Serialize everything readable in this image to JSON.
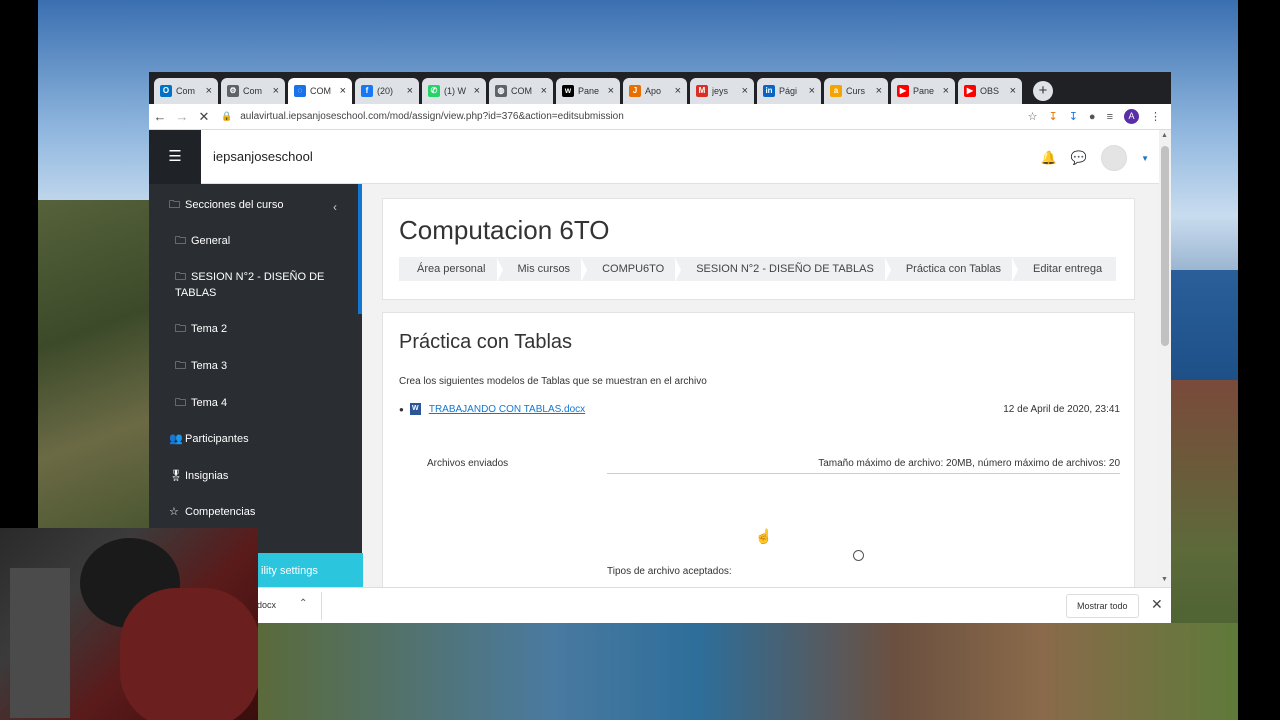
{
  "browser": {
    "tabs": [
      {
        "label": "Com",
        "favicon": "outlook-icon",
        "color": "#0072c6"
      },
      {
        "label": "Com",
        "favicon": "settings-icon",
        "color": "#5f6368"
      },
      {
        "label": "COM",
        "favicon": "loading-icon",
        "color": "#1a73e8"
      },
      {
        "label": "(20)",
        "favicon": "facebook-icon",
        "color": "#1877f2"
      },
      {
        "label": "(1) W",
        "favicon": "whatsapp-icon",
        "color": "#25d366"
      },
      {
        "label": "COM",
        "favicon": "globe-icon",
        "color": "#5f6368"
      },
      {
        "label": "Pane",
        "favicon": "wix-icon",
        "color": "#000000"
      },
      {
        "label": "Apo",
        "favicon": "java-icon",
        "color": "#e76f00"
      },
      {
        "label": "jeys",
        "favicon": "gmail-icon",
        "color": "#d93025"
      },
      {
        "label": "Pági",
        "favicon": "linkedin-icon",
        "color": "#0a66c2"
      },
      {
        "label": "Curs",
        "favicon": "ac-icon",
        "color": "#f4a300"
      },
      {
        "label": "Pane",
        "favicon": "youtube-icon",
        "color": "#ff0000"
      },
      {
        "label": "OBS",
        "favicon": "youtube-icon",
        "color": "#ff0000"
      }
    ],
    "new_tab": "+",
    "url": "aulavirtual.iepsanjoseschool.com/mod/assign/view.php?id=376&action=editsubmission",
    "profile_initial": "A"
  },
  "site": {
    "name": "iepsanjoseschool"
  },
  "drawer": {
    "items": [
      {
        "label": "Secciones del curso",
        "icon": "folder-icon"
      },
      {
        "label": "General",
        "icon": "folder-icon"
      },
      {
        "label": "SESION N°2 - DISEÑO DE",
        "label2": "TABLAS",
        "icon": "folder-icon"
      },
      {
        "label": "Tema 2",
        "icon": "folder-icon"
      },
      {
        "label": "Tema 3",
        "icon": "folder-icon"
      },
      {
        "label": "Tema 4",
        "icon": "folder-icon"
      },
      {
        "label": "Participantes",
        "icon": "users-icon"
      },
      {
        "label": "Insignias",
        "icon": "badge-icon"
      },
      {
        "label": "Competencias",
        "icon": "star-icon"
      }
    ],
    "accessibility_label": "ility settings"
  },
  "course": {
    "title": "Computacion 6TO",
    "breadcrumbs": [
      "Área personal",
      "Mis cursos",
      "COMPU6TO",
      "SESION N°2 - DISEÑO DE TABLAS",
      "Práctica con Tablas",
      "Editar entrega"
    ]
  },
  "assignment": {
    "title": "Práctica con Tablas",
    "intro": "Crea los siguientes modelos de Tablas que se muestran en el archivo",
    "file_name": "TRABAJANDO CON TABLAS.docx",
    "file_date": "12 de April de 2020, 23:41",
    "files_label": "Archivos enviados",
    "files_limit": "Tamaño máximo de archivo: 20MB, número máximo de archivos: 20",
    "accepted_types_label": "Tipos de archivo aceptados:"
  },
  "download_bar": {
    "file": "docx",
    "show_all": "Mostrar todo"
  }
}
